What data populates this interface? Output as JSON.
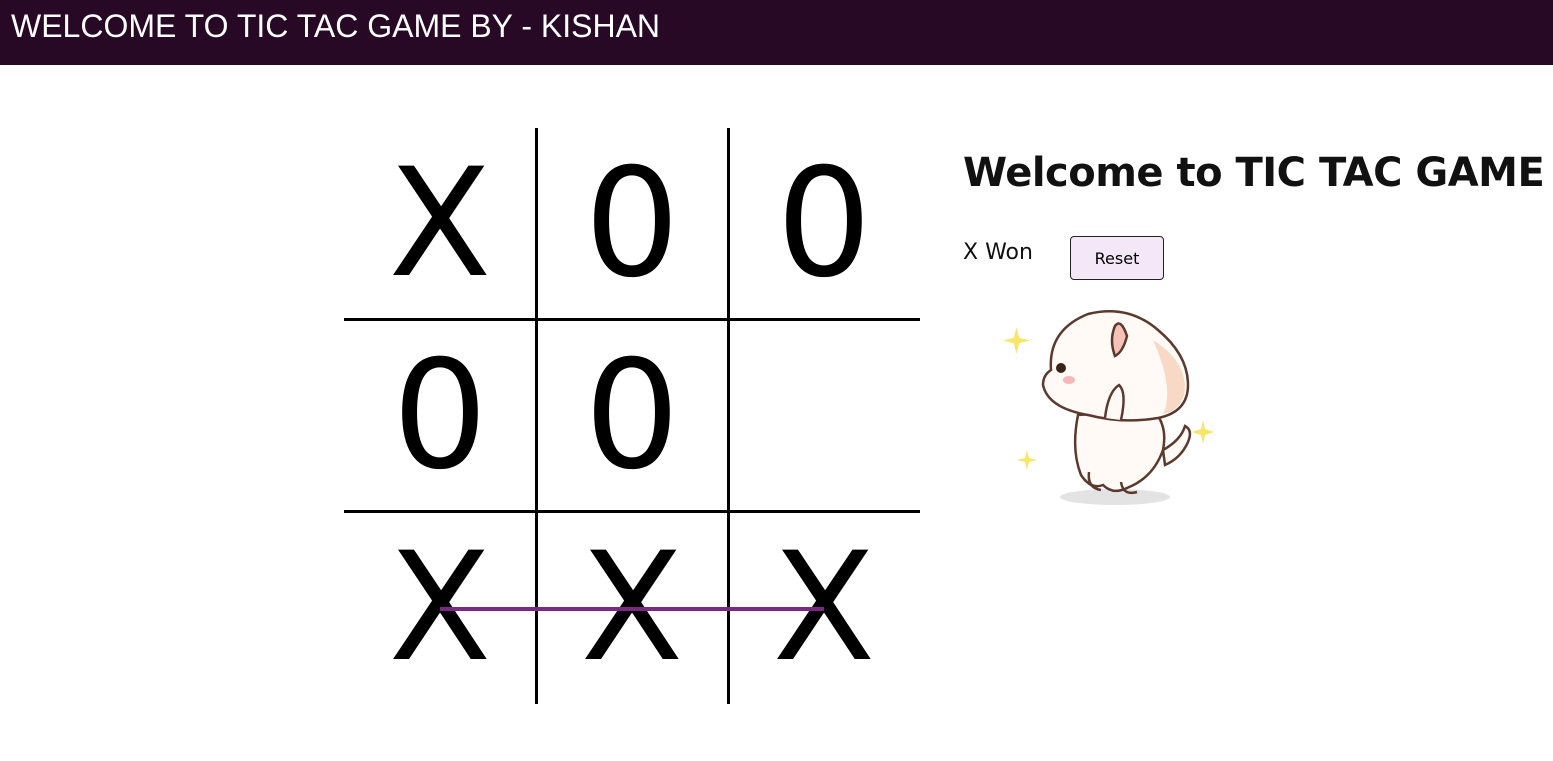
{
  "header": {
    "title": "WELCOME TO TIC TAC GAME BY - KISHAN",
    "background_color": "#270926"
  },
  "board": {
    "cells": [
      "X",
      "0",
      "0",
      "0",
      "0",
      "",
      "X",
      "X",
      "X"
    ],
    "winning_row": [
      6,
      7,
      8
    ],
    "win_line_color": "#7b2a82"
  },
  "side_panel": {
    "heading": "Welcome to TIC TAC GAME",
    "status": "X Won",
    "reset_label": "Reset",
    "reset_button_color": "#f3e7f8"
  },
  "mascot": {
    "icon": "cute-cat-icon",
    "sparkle_color": "#f7e66a"
  }
}
